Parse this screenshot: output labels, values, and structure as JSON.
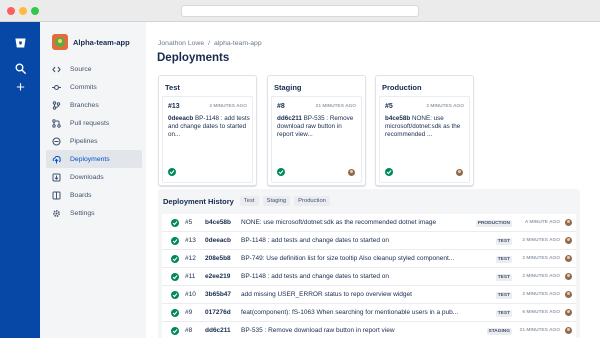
{
  "sidebar": {
    "repo_name": "Alpha-team-app",
    "items": [
      {
        "label": "Source",
        "icon": "source-code-icon"
      },
      {
        "label": "Commits",
        "icon": "commits-icon"
      },
      {
        "label": "Branches",
        "icon": "branches-icon"
      },
      {
        "label": "Pull requests",
        "icon": "pull-request-icon"
      },
      {
        "label": "Pipelines",
        "icon": "pipelines-icon"
      },
      {
        "label": "Deployments",
        "icon": "deployments-icon",
        "active": true
      },
      {
        "label": "Downloads",
        "icon": "downloads-icon"
      },
      {
        "label": "Boards",
        "icon": "boards-icon"
      },
      {
        "label": "Settings",
        "icon": "settings-gear-icon"
      }
    ]
  },
  "breadcrumb": {
    "user": "Jonathon Lowe",
    "separator": "/",
    "repo": "alpha-team-app"
  },
  "page_title": "Deployments",
  "environments": [
    {
      "name": "Test",
      "number": "#13",
      "time": "2 MINUTES AGO",
      "hash": "0deeacb",
      "message": "BP-1148 : add tests and change dates to started on...",
      "has_avatar": false
    },
    {
      "name": "Staging",
      "number": "#8",
      "time": "21 MINUTES AGO",
      "hash": "dd6c211",
      "message": "BP-535 : Remove download raw button in report view...",
      "has_avatar": true
    },
    {
      "name": "Production",
      "number": "#5",
      "time": "2 MINUTES AGO",
      "hash": "b4ce58b",
      "message": "NONE: use microsoft/dotnet:sdk as the recommended ...",
      "has_avatar": true
    }
  ],
  "history": {
    "title": "Deployment History",
    "filters": [
      "Test",
      "Staging",
      "Production"
    ],
    "rows": [
      {
        "number": "#5",
        "hash": "b4ce58b",
        "message": "NONE: use microsoft/dotnet:sdk as the recommended dotnet image",
        "env": "PRODUCTION",
        "time": "A MINUTE AGO"
      },
      {
        "number": "#13",
        "hash": "0deeacb",
        "message": "BP-1148 : add tests and change dates to started on",
        "env": "TEST",
        "time": "2 MINUTES AGO"
      },
      {
        "number": "#12",
        "hash": "208e5b8",
        "message": "BP-749: Use definition list for size tooltip Also cleanup styled component...",
        "env": "TEST",
        "time": "2 MINUTES AGO"
      },
      {
        "number": "#11",
        "hash": "e2ee219",
        "message": "BP-1148 : add tests and change dates to started on",
        "env": "TEST",
        "time": "2 MINUTES AGO"
      },
      {
        "number": "#10",
        "hash": "3b65b47",
        "message": "add missing USER_ERROR status to repo overview widget",
        "env": "TEST",
        "time": "2 MINUTES AGO"
      },
      {
        "number": "#9",
        "hash": "017276d",
        "message": "feat(component): fS-1063 When searching for mentionable users in a pub...",
        "env": "TEST",
        "time": "6 MINUTES AGO"
      },
      {
        "number": "#8",
        "hash": "dd6c211",
        "message": "BP-535 : Remove download raw button in report view",
        "env": "STAGING",
        "time": "21 MINUTES AGO"
      }
    ]
  },
  "colors": {
    "global_nav": "#0747a6",
    "success": "#00875a",
    "active_link": "#0052cc"
  }
}
